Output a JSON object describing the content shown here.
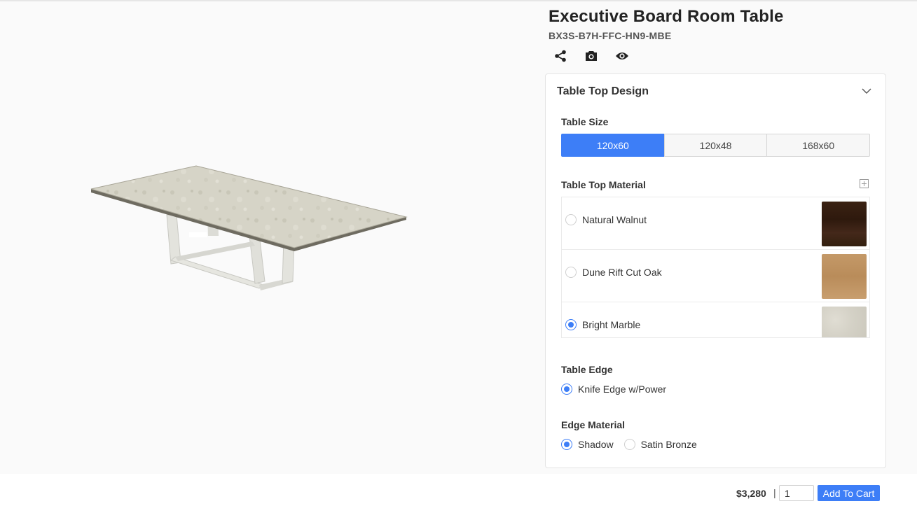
{
  "product": {
    "title": "Executive Board Room Table",
    "sku": "BX3S-B7H-FFC-HN9-MBE"
  },
  "actions": [
    {
      "icon": "share-icon"
    },
    {
      "icon": "camera-icon"
    },
    {
      "icon": "eye-icon"
    }
  ],
  "panel": {
    "title": "Table Top Design",
    "table_size": {
      "label": "Table Size",
      "options": [
        "120x60",
        "120x48",
        "168x60"
      ],
      "selected": "120x60"
    },
    "table_top_material": {
      "label": "Table Top Material",
      "options": [
        {
          "name": "Natural Walnut",
          "swatch": "#3b2213",
          "selected": false
        },
        {
          "name": "Dune Rift Cut Oak",
          "swatch": "#c49968",
          "selected": false
        },
        {
          "name": "Bright Marble",
          "swatch": "#d4d1c6",
          "selected": true
        }
      ]
    },
    "table_edge": {
      "label": "Table Edge",
      "options": [
        {
          "name": "Knife Edge w/Power",
          "selected": true
        }
      ]
    },
    "edge_material": {
      "label": "Edge Material",
      "options": [
        {
          "name": "Shadow",
          "selected": true
        },
        {
          "name": "Satin Bronze",
          "selected": false
        }
      ]
    }
  },
  "footer": {
    "price": "$3,280",
    "separator": "|",
    "quantity": "1",
    "add_to_cart": "Add To Cart"
  },
  "colors": {
    "accent": "#3d7ef7",
    "marble": "#d6d4c7",
    "base_metal": "#e2e2dc"
  }
}
